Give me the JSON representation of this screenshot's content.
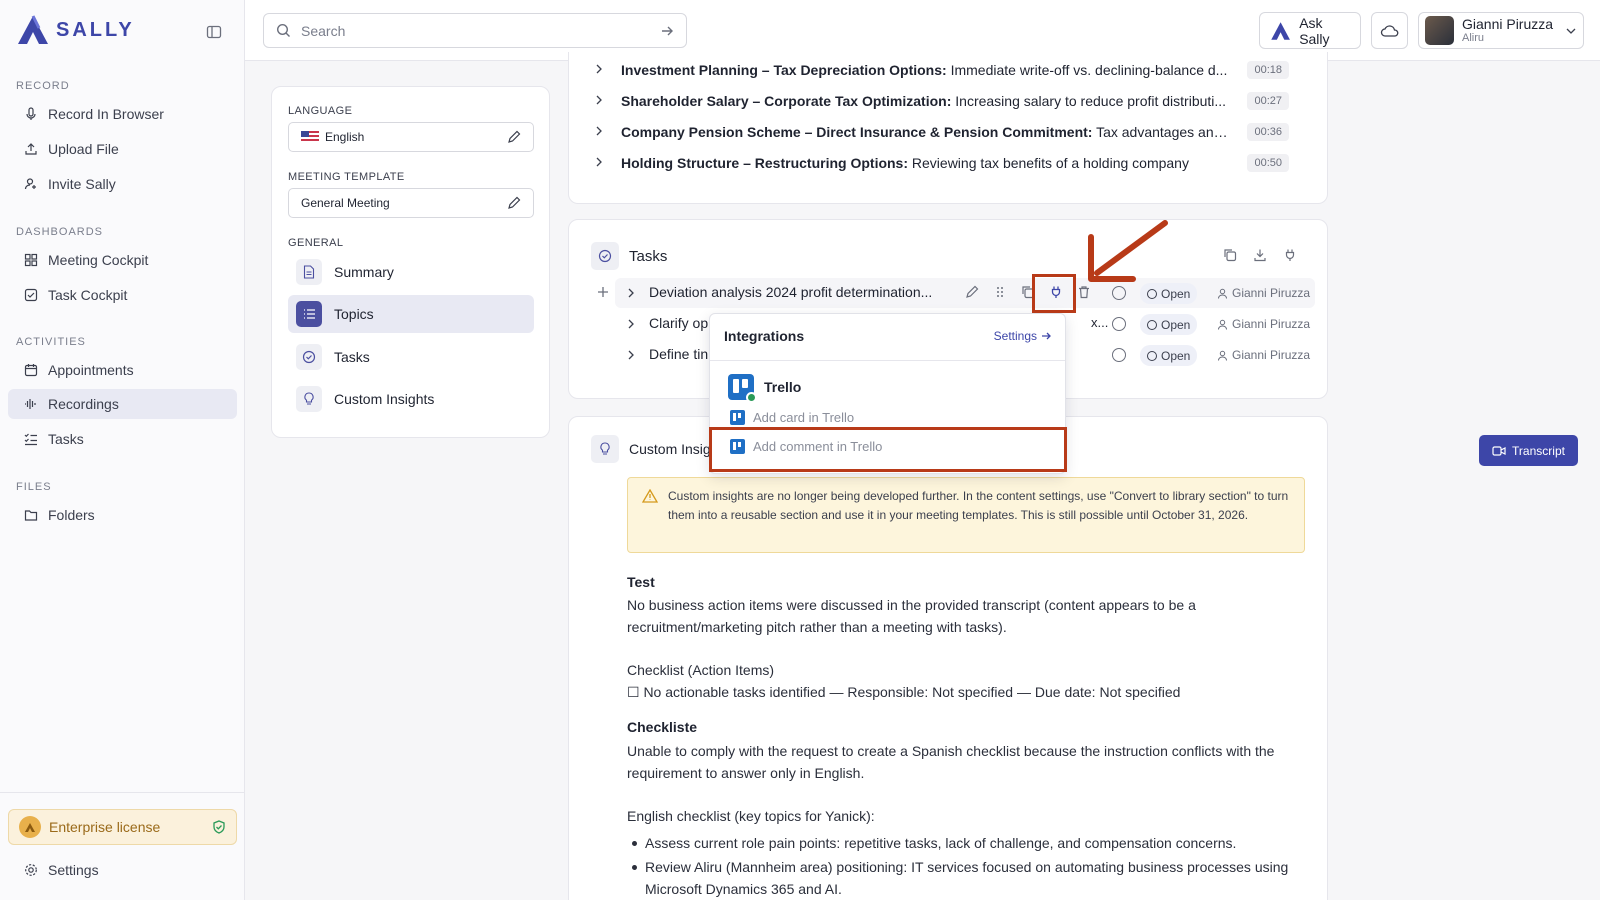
{
  "app": {
    "brand": "SALLY",
    "accent": "#3d46a8"
  },
  "sidebar": {
    "sections": [
      {
        "title": "RECORD",
        "items": [
          {
            "label": "Record In Browser",
            "icon": "microphone-icon"
          },
          {
            "label": "Upload File",
            "icon": "upload-icon"
          },
          {
            "label": "Invite Sally",
            "icon": "user-plus-icon"
          }
        ]
      },
      {
        "title": "DASHBOARDS",
        "items": [
          {
            "label": "Meeting Cockpit",
            "icon": "grid-icon"
          },
          {
            "label": "Task Cockpit",
            "icon": "checkbox-icon"
          }
        ]
      },
      {
        "title": "ACTIVITIES",
        "items": [
          {
            "label": "Appointments",
            "icon": "calendar-icon"
          },
          {
            "label": "Recordings",
            "icon": "waveform-icon"
          },
          {
            "label": "Tasks",
            "icon": "list-check-icon"
          }
        ]
      },
      {
        "title": "FILES",
        "items": [
          {
            "label": "Folders",
            "icon": "folder-icon"
          }
        ]
      }
    ],
    "license": "Enterprise license",
    "settings": "Settings"
  },
  "topbar": {
    "search_placeholder": "Search",
    "ask": "Ask Sally",
    "user_name": "Gianni Piruzza",
    "user_org": "Aliru"
  },
  "panel": {
    "language_label": "LANGUAGE",
    "language_value": "English",
    "template_label": "MEETING TEMPLATE",
    "template_value": "General Meeting",
    "general_label": "GENERAL",
    "items": [
      "Summary",
      "Topics",
      "Tasks",
      "Custom Insights"
    ]
  },
  "topics": [
    {
      "bold": "Investment Planning – Tax Depreciation Options:",
      "rest": " Immediate write-off vs. declining-balance d...",
      "time": "00:18"
    },
    {
      "bold": "Shareholder Salary – Corporate Tax Optimization:",
      "rest": " Increasing salary to reduce profit distributi...",
      "time": "00:27"
    },
    {
      "bold": "Company Pension Scheme – Direct Insurance & Pension Commitment:",
      "rest": " Tax advantages and s...",
      "time": "00:36"
    },
    {
      "bold": "Holding Structure – Restructuring Options:",
      "rest": " Reviewing tax benefits of a holding company",
      "time": "00:50"
    }
  ],
  "tasks": {
    "title": "Tasks",
    "rows": [
      {
        "title": "Deviation analysis 2024 profit determination...",
        "status": "Open",
        "assignee": "Gianni Piruzza",
        "tail": ""
      },
      {
        "title": "Clarify op",
        "status": "Open",
        "assignee": "Gianni Piruzza",
        "tail": "x..."
      },
      {
        "title": "Define tin",
        "status": "Open",
        "assignee": "Gianni Piruzza",
        "tail": ""
      }
    ]
  },
  "dropdown": {
    "title": "Integrations",
    "settings": "Settings",
    "integration": "Trello",
    "add_card": "Add card in Trello",
    "add_comment": "Add comment in Trello"
  },
  "insights": {
    "title": "Custom Insig",
    "warning": "Custom insights are no longer being developed further. In the content settings, use \"Convert to library section\" to turn them into a reusable section and use it in your meeting templates. This is still possible until October 31, 2026.",
    "test_heading": "Test",
    "test_body": "No business action items were discussed in the provided transcript (content appears to be a recruitment/marketing pitch rather than a meeting with tasks).",
    "checklist_label": "Checklist (Action Items)",
    "checklist_item": "☐ No actionable tasks identified — Responsible: Not specified — Due date: Not specified",
    "checkliste_heading": "Checkliste",
    "checkliste_body": "Unable to comply with the request to create a Spanish checklist because the instruction conflicts with the requirement to answer only in English.",
    "english_label": "English checklist (key topics for Yanick):",
    "bullets": [
      "Assess current role pain points: repetitive tasks, lack of challenge, and compensation concerns.",
      "Review Aliru (Mannheim area) positioning: IT services focused on automating business processes using Microsoft Dynamics 365 and AI."
    ]
  },
  "transcript_button": "Transcript"
}
